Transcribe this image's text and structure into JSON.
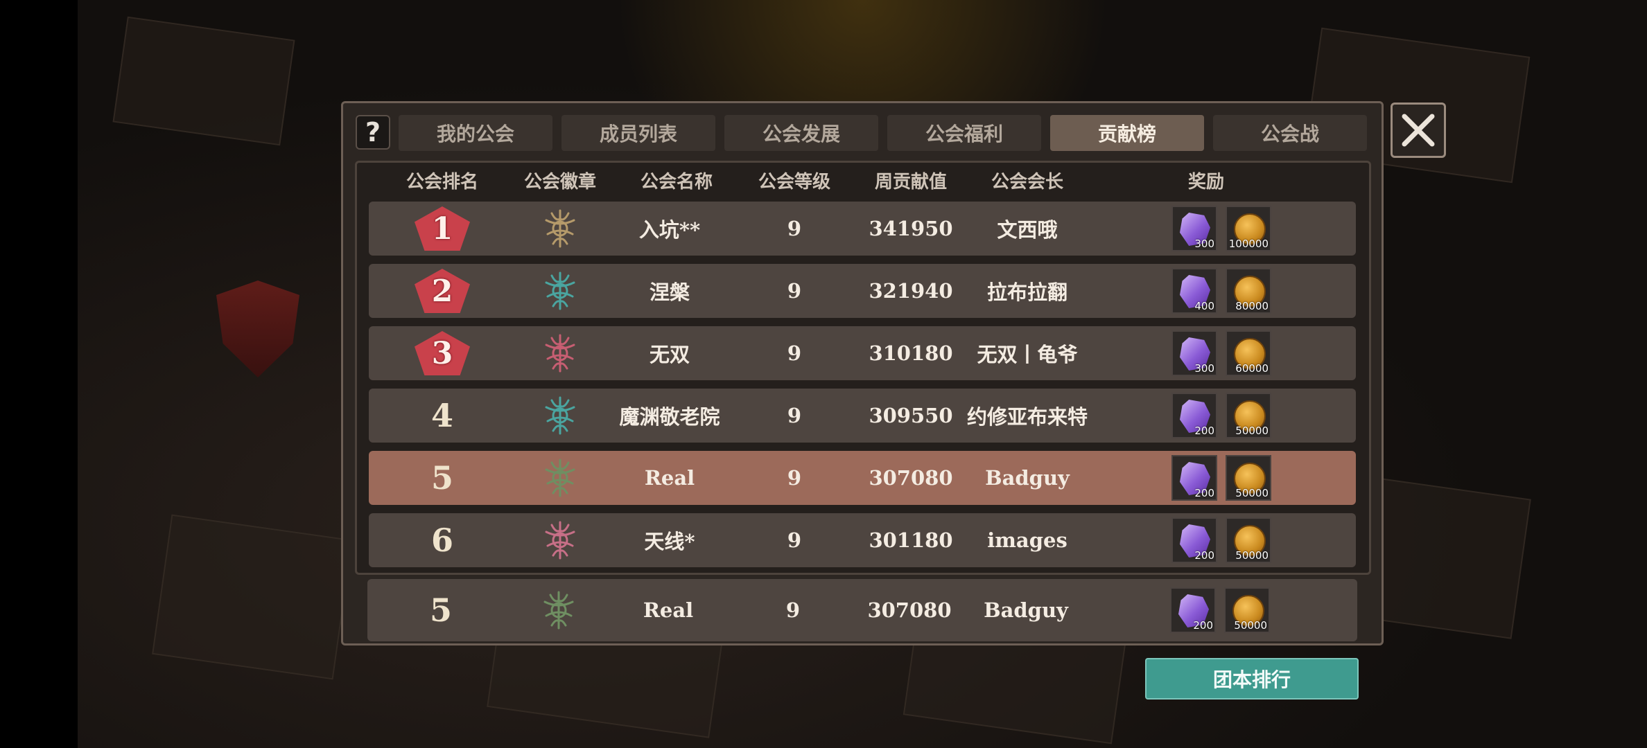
{
  "tabs": [
    {
      "label": "我的公会",
      "active": false
    },
    {
      "label": "成员列表",
      "active": false
    },
    {
      "label": "公会发展",
      "active": false
    },
    {
      "label": "公会福利",
      "active": false
    },
    {
      "label": "贡献榜",
      "active": true
    },
    {
      "label": "公会战",
      "active": false
    }
  ],
  "help_icon": "question-icon",
  "close_icon": "close-icon",
  "headers": {
    "rank": "公会排名",
    "emblem": "公会徽章",
    "name": "公会名称",
    "level": "公会等级",
    "weekly": "周贡献值",
    "leader": "公会会长",
    "reward": "奖励"
  },
  "rows": [
    {
      "rank": "1",
      "name": "入坑**",
      "level": "9",
      "weekly": "341950",
      "leader": "文西哦",
      "gem_qty": "300",
      "coin_qty": "100000",
      "emblem_color": "#b59a6a",
      "medal": true
    },
    {
      "rank": "2",
      "name": "涅槃",
      "level": "9",
      "weekly": "321940",
      "leader": "拉布拉翻",
      "gem_qty": "400",
      "coin_qty": "80000",
      "emblem_color": "#4aa5a0",
      "medal": true
    },
    {
      "rank": "3",
      "name": "无双",
      "level": "9",
      "weekly": "310180",
      "leader": "无双丨龟爷",
      "gem_qty": "300",
      "coin_qty": "60000",
      "emblem_color": "#c75e72",
      "medal": true
    },
    {
      "rank": "4",
      "name": "魔渊敬老院",
      "level": "9",
      "weekly": "309550",
      "leader": "约修亚布来特",
      "gem_qty": "200",
      "coin_qty": "50000",
      "emblem_color": "#4aa5a0",
      "medal": false
    },
    {
      "rank": "5",
      "name": "Real",
      "level": "9",
      "weekly": "307080",
      "leader": "Badguy",
      "gem_qty": "200",
      "coin_qty": "50000",
      "emblem_color": "#6f8f62",
      "medal": false
    },
    {
      "rank": "6",
      "name": "天线*",
      "level": "9",
      "weekly": "301180",
      "leader": "images",
      "gem_qty": "200",
      "coin_qty": "50000",
      "emblem_color": "#c76f87",
      "medal": false
    }
  ],
  "my_row": {
    "rank": "5",
    "name": "Real",
    "level": "9",
    "weekly": "307080",
    "leader": "Badguy",
    "gem_qty": "200",
    "coin_qty": "50000",
    "emblem_color": "#6f8f62"
  },
  "team_rank_button": "团本排行",
  "colors": {
    "panel": "#2c2622",
    "row": "#4e4540",
    "row_highlight": "#9c6a5a",
    "medal": "#c9414b",
    "team_button": "#3f9b8f"
  }
}
